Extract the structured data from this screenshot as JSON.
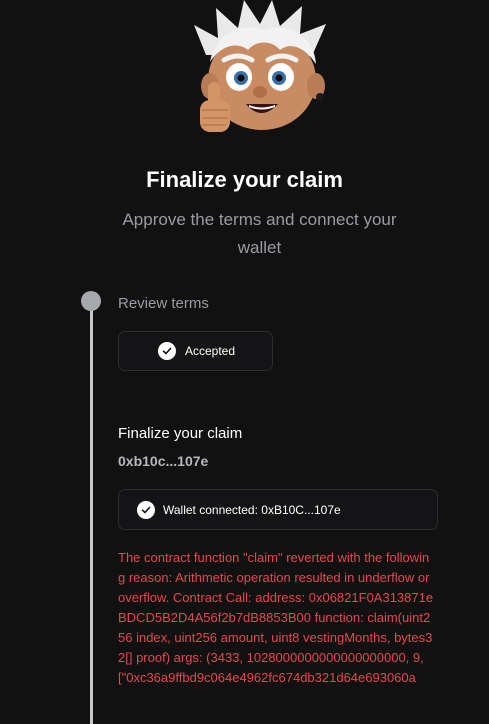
{
  "avatar": {
    "icon": "thumbs-up-character-avatar"
  },
  "header": {
    "title": "Finalize your claim",
    "subtitle": "Approve the terms and connect your wallet"
  },
  "steps": {
    "review": {
      "label": "Review terms",
      "status_label": "Accepted",
      "status_icon": "checkmark-icon"
    },
    "finalize": {
      "label": "Finalize your claim",
      "wallet_address": "0xb10c...107e",
      "wallet_status": "Wallet connected: 0xB10C...107e",
      "status_icon": "checkmark-icon"
    }
  },
  "error": {
    "message": "The contract function \"claim\" reverted with the following reason: Arithmetic operation resulted in underflow or overflow. Contract Call: address: 0x06821F0A313871eBDCD5B2D4A56f2b7dB8853B00 function: claim(uint256 index, uint256 amount, uint8 vestingMonths, bytes32[] proof) args: (3433, 1028000000000000000000, 9, [\"0xc36a9ffbd9c064e4962fc674db321d64e693060a"
  },
  "colors": {
    "background": "#111112",
    "error": "#e5484d",
    "muted": "#9a9ba2",
    "timeline": "#c7c8cc"
  }
}
